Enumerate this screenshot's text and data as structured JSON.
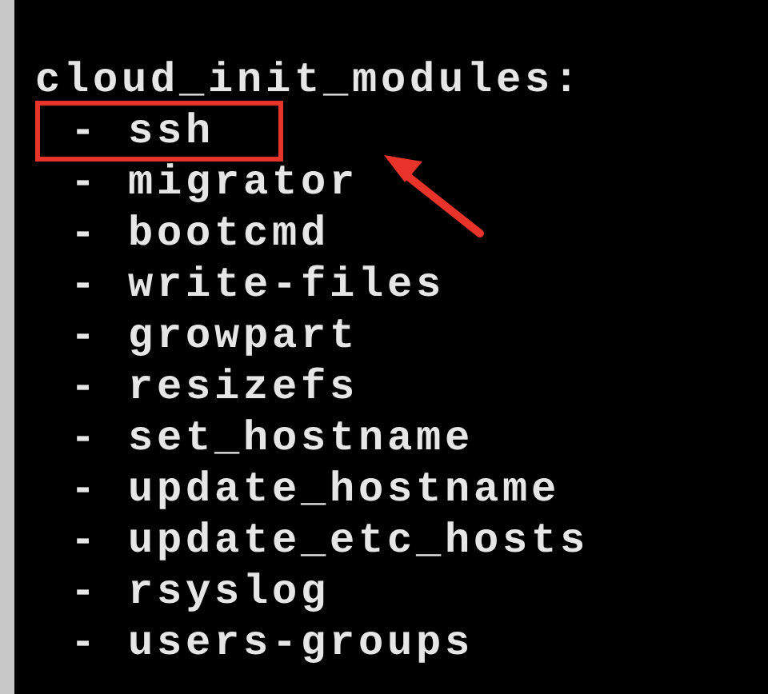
{
  "heading": "cloud_init_modules:",
  "items": [
    {
      "text": "- ssh",
      "highlighted": true
    },
    {
      "text": "- migrator",
      "highlighted": false
    },
    {
      "text": "- bootcmd",
      "highlighted": false
    },
    {
      "text": "- write-files",
      "highlighted": false
    },
    {
      "text": "- growpart",
      "highlighted": false
    },
    {
      "text": "- resizefs",
      "highlighted": false
    },
    {
      "text": "- set_hostname",
      "highlighted": false
    },
    {
      "text": "- update_hostname",
      "highlighted": false
    },
    {
      "text": "- update_etc_hosts",
      "highlighted": false
    },
    {
      "text": "- rsyslog",
      "highlighted": false
    },
    {
      "text": "- users-groups",
      "highlighted": false
    }
  ]
}
